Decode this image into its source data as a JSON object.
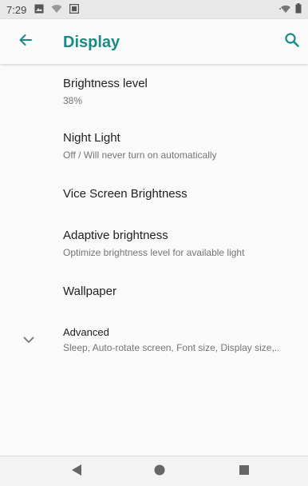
{
  "status_bar": {
    "time": "7:29",
    "icons": [
      "image-notification-icon",
      "wifi-notification-icon",
      "media-notification-icon"
    ],
    "right_icons": [
      "wifi-signal-icon",
      "battery-icon"
    ]
  },
  "app_bar": {
    "title": "Display",
    "accent_color": "#1a8a82",
    "back_icon": "arrow-left-icon",
    "search_icon": "search-icon"
  },
  "settings": {
    "items": [
      {
        "title": "Brightness level",
        "summary": "38%"
      },
      {
        "title": "Night Light",
        "summary": "Off / Will never turn on automatically"
      },
      {
        "title": "Vice Screen Brightness",
        "summary": ""
      },
      {
        "title": "Adaptive brightness",
        "summary": "Optimize brightness level for available light"
      },
      {
        "title": "Wallpaper",
        "summary": ""
      },
      {
        "title": "Advanced",
        "summary": "Sleep, Auto-rotate screen, Font size, Display size,.."
      }
    ]
  },
  "nav_bar": {
    "buttons": [
      "back-triangle-icon",
      "home-circle-icon",
      "recents-square-icon"
    ]
  }
}
